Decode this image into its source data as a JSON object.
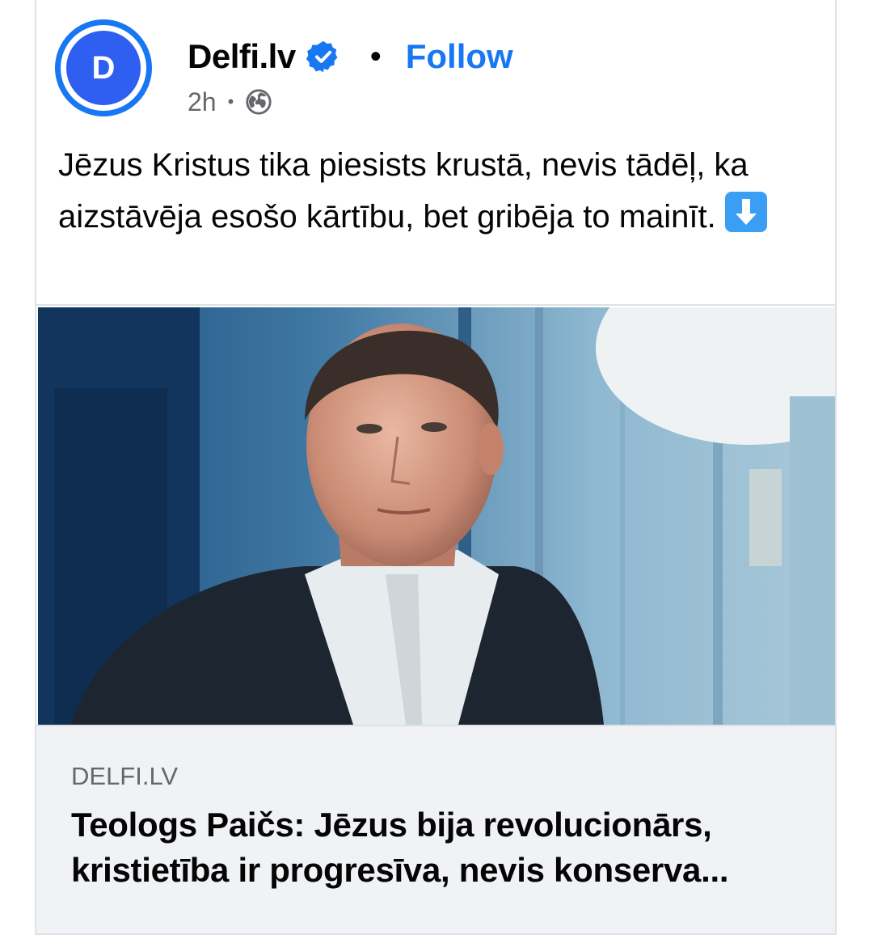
{
  "post": {
    "page_name": "Delfi.lv",
    "avatar_letter": "D",
    "verified_icon": "verified-badge-icon",
    "separator": "•",
    "follow_label": "Follow",
    "time": "2h",
    "meta_separator": "•",
    "audience_icon": "globe-icon",
    "text": "Jēzus Kristus tika piesists krustā, nevis tādēļ, ka aizstāvēja esošo kārtību, bet gribēja to mainīt.",
    "text_emoji": "down-arrow-emoji"
  },
  "link_preview": {
    "domain": "DELFI.LV",
    "title": "Teologs Paičs: Jēzus bija revolucionārs, kristietība ir progresīva, nevis konserva..."
  },
  "colors": {
    "accent": "#1877f2",
    "secondary_text": "#65676b",
    "link_bg": "#f0f2f5"
  }
}
